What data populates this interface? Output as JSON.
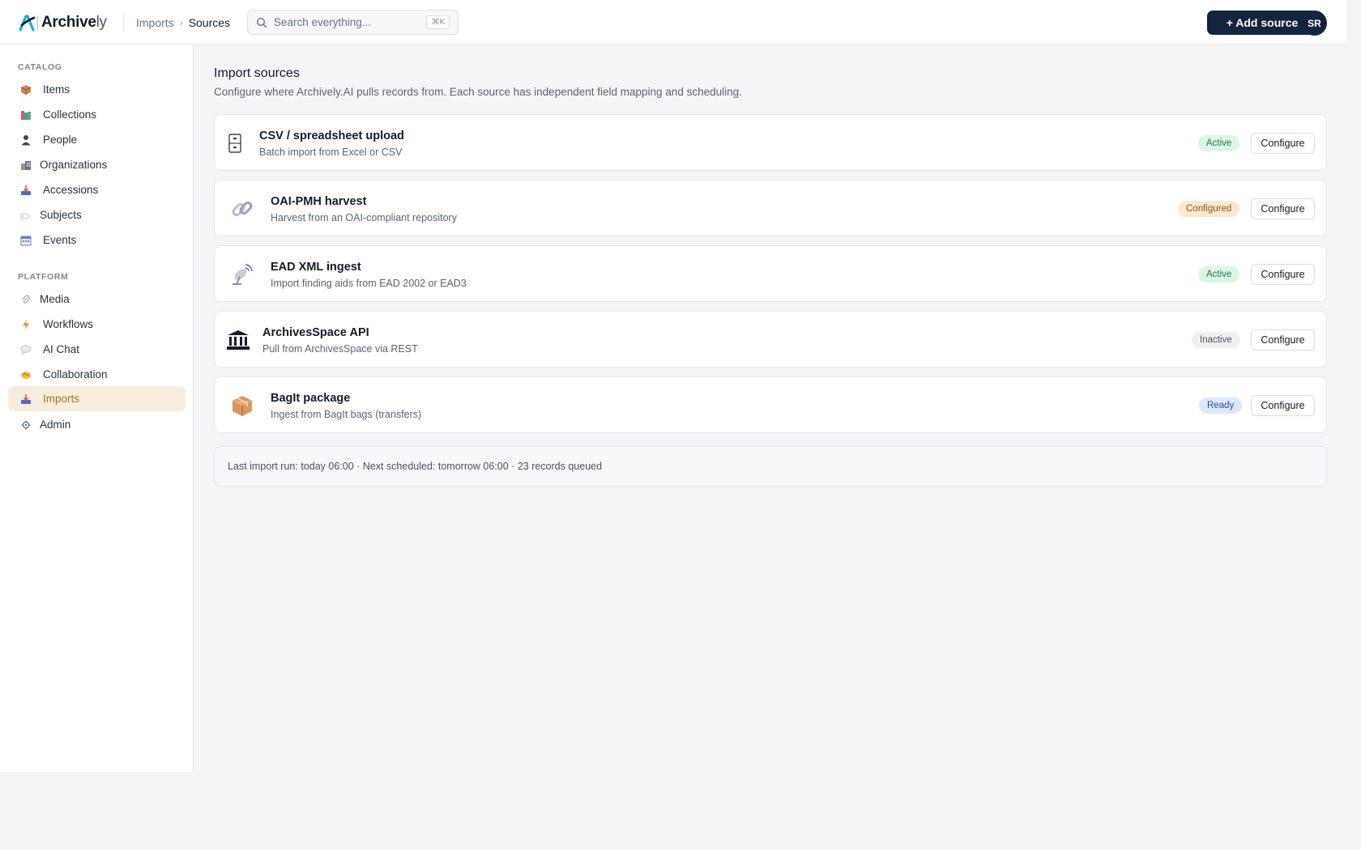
{
  "app": {
    "logo_bold": "Archive",
    "logo_light": "ly"
  },
  "header": {
    "breadcrumb_parent": "Imports",
    "breadcrumb_separator": "›",
    "breadcrumb_current": "Sources",
    "search_placeholder": "Search everything...",
    "search_shortcut": "⌘K",
    "add_button": "+ Add source",
    "avatar_initials": "SR",
    "accent_color": "#14243f"
  },
  "sidebar": {
    "catalog_label": "CATALOG",
    "catalog_items": [
      {
        "label": "Items",
        "icon": "package-icon"
      },
      {
        "label": "Collections",
        "icon": "books-icon"
      },
      {
        "label": "People",
        "icon": "person-icon"
      },
      {
        "label": "Organizations",
        "icon": "buildings-icon"
      },
      {
        "label": "Accessions",
        "icon": "inbox-tray-icon"
      },
      {
        "label": "Subjects",
        "icon": "tag-icon"
      },
      {
        "label": "Events",
        "icon": "calendar-icon"
      }
    ],
    "platform_label": "PLATFORM",
    "platform_items": [
      {
        "label": "Media",
        "icon": "paperclip-icon"
      },
      {
        "label": "Workflows",
        "icon": "lightning-icon"
      },
      {
        "label": "AI Chat",
        "icon": "speech-bubble-icon"
      },
      {
        "label": "Collaboration",
        "icon": "handshake-icon"
      },
      {
        "label": "Imports",
        "icon": "inbox-tray-icon",
        "active": true
      },
      {
        "label": "Admin",
        "icon": "gear-icon"
      }
    ],
    "active_color": "#a77425",
    "active_bg": "#f7eddb"
  },
  "main": {
    "title": "Import sources",
    "subtitle": "Configure where Archively.AI pulls records from. Each source has independent field mapping and scheduling.",
    "configure_label": "Configure",
    "sources": [
      {
        "name": "CSV / spreadsheet upload",
        "description": "Batch import from Excel or CSV",
        "status": "Active",
        "icon": "file-cabinet-icon",
        "status_bg": "#dcf5e6",
        "status_color": "#1d7a45"
      },
      {
        "name": "OAI-PMH harvest",
        "description": "Harvest from an OAI-compliant repository",
        "status": "Configured",
        "icon": "link-icon",
        "status_bg": "#fbe8cf",
        "status_color": "#8a5414"
      },
      {
        "name": "EAD XML ingest",
        "description": "Import finding aids from EAD 2002 or EAD3",
        "status": "Active",
        "icon": "satellite-dish-icon",
        "status_bg": "#dcf5e6",
        "status_color": "#1d7a45"
      },
      {
        "name": "ArchivesSpace API",
        "description": "Pull from ArchivesSpace via REST",
        "status": "Inactive",
        "icon": "bank-icon",
        "status_bg": "#eef0f3",
        "status_color": "#4a5466"
      },
      {
        "name": "BagIt package",
        "description": "Ingest from BagIt bags (transfers)",
        "status": "Ready",
        "icon": "package-icon",
        "status_bg": "#dde8fb",
        "status_color": "#1f4fa8"
      }
    ],
    "footer": "Last import run: today 06:00 · Next scheduled: tomorrow 06:00 · 23 records queued"
  }
}
